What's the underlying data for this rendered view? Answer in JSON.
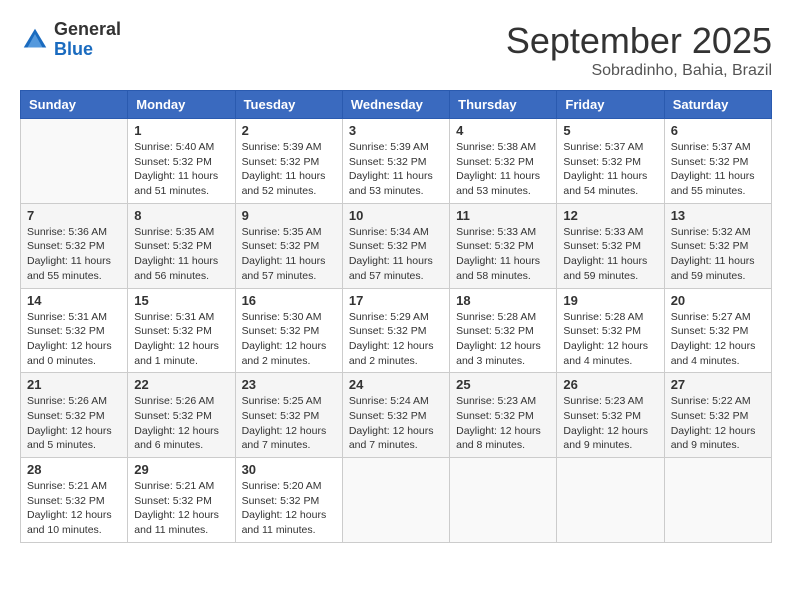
{
  "logo": {
    "general": "General",
    "blue": "Blue"
  },
  "header": {
    "month": "September 2025",
    "location": "Sobradinho, Bahia, Brazil"
  },
  "weekdays": [
    "Sunday",
    "Monday",
    "Tuesday",
    "Wednesday",
    "Thursday",
    "Friday",
    "Saturday"
  ],
  "weeks": [
    [
      {
        "day": "",
        "empty": true
      },
      {
        "day": "1",
        "sunrise": "5:40 AM",
        "sunset": "5:32 PM",
        "daylight": "11 hours and 51 minutes."
      },
      {
        "day": "2",
        "sunrise": "5:39 AM",
        "sunset": "5:32 PM",
        "daylight": "11 hours and 52 minutes."
      },
      {
        "day": "3",
        "sunrise": "5:39 AM",
        "sunset": "5:32 PM",
        "daylight": "11 hours and 53 minutes."
      },
      {
        "day": "4",
        "sunrise": "5:38 AM",
        "sunset": "5:32 PM",
        "daylight": "11 hours and 53 minutes."
      },
      {
        "day": "5",
        "sunrise": "5:37 AM",
        "sunset": "5:32 PM",
        "daylight": "11 hours and 54 minutes."
      },
      {
        "day": "6",
        "sunrise": "5:37 AM",
        "sunset": "5:32 PM",
        "daylight": "11 hours and 55 minutes."
      }
    ],
    [
      {
        "day": "7",
        "sunrise": "5:36 AM",
        "sunset": "5:32 PM",
        "daylight": "11 hours and 55 minutes."
      },
      {
        "day": "8",
        "sunrise": "5:35 AM",
        "sunset": "5:32 PM",
        "daylight": "11 hours and 56 minutes."
      },
      {
        "day": "9",
        "sunrise": "5:35 AM",
        "sunset": "5:32 PM",
        "daylight": "11 hours and 57 minutes."
      },
      {
        "day": "10",
        "sunrise": "5:34 AM",
        "sunset": "5:32 PM",
        "daylight": "11 hours and 57 minutes."
      },
      {
        "day": "11",
        "sunrise": "5:33 AM",
        "sunset": "5:32 PM",
        "daylight": "11 hours and 58 minutes."
      },
      {
        "day": "12",
        "sunrise": "5:33 AM",
        "sunset": "5:32 PM",
        "daylight": "11 hours and 59 minutes."
      },
      {
        "day": "13",
        "sunrise": "5:32 AM",
        "sunset": "5:32 PM",
        "daylight": "11 hours and 59 minutes."
      }
    ],
    [
      {
        "day": "14",
        "sunrise": "5:31 AM",
        "sunset": "5:32 PM",
        "daylight": "12 hours and 0 minutes."
      },
      {
        "day": "15",
        "sunrise": "5:31 AM",
        "sunset": "5:32 PM",
        "daylight": "12 hours and 1 minute."
      },
      {
        "day": "16",
        "sunrise": "5:30 AM",
        "sunset": "5:32 PM",
        "daylight": "12 hours and 2 minutes."
      },
      {
        "day": "17",
        "sunrise": "5:29 AM",
        "sunset": "5:32 PM",
        "daylight": "12 hours and 2 minutes."
      },
      {
        "day": "18",
        "sunrise": "5:28 AM",
        "sunset": "5:32 PM",
        "daylight": "12 hours and 3 minutes."
      },
      {
        "day": "19",
        "sunrise": "5:28 AM",
        "sunset": "5:32 PM",
        "daylight": "12 hours and 4 minutes."
      },
      {
        "day": "20",
        "sunrise": "5:27 AM",
        "sunset": "5:32 PM",
        "daylight": "12 hours and 4 minutes."
      }
    ],
    [
      {
        "day": "21",
        "sunrise": "5:26 AM",
        "sunset": "5:32 PM",
        "daylight": "12 hours and 5 minutes."
      },
      {
        "day": "22",
        "sunrise": "5:26 AM",
        "sunset": "5:32 PM",
        "daylight": "12 hours and 6 minutes."
      },
      {
        "day": "23",
        "sunrise": "5:25 AM",
        "sunset": "5:32 PM",
        "daylight": "12 hours and 7 minutes."
      },
      {
        "day": "24",
        "sunrise": "5:24 AM",
        "sunset": "5:32 PM",
        "daylight": "12 hours and 7 minutes."
      },
      {
        "day": "25",
        "sunrise": "5:23 AM",
        "sunset": "5:32 PM",
        "daylight": "12 hours and 8 minutes."
      },
      {
        "day": "26",
        "sunrise": "5:23 AM",
        "sunset": "5:32 PM",
        "daylight": "12 hours and 9 minutes."
      },
      {
        "day": "27",
        "sunrise": "5:22 AM",
        "sunset": "5:32 PM",
        "daylight": "12 hours and 9 minutes."
      }
    ],
    [
      {
        "day": "28",
        "sunrise": "5:21 AM",
        "sunset": "5:32 PM",
        "daylight": "12 hours and 10 minutes."
      },
      {
        "day": "29",
        "sunrise": "5:21 AM",
        "sunset": "5:32 PM",
        "daylight": "12 hours and 11 minutes."
      },
      {
        "day": "30",
        "sunrise": "5:20 AM",
        "sunset": "5:32 PM",
        "daylight": "12 hours and 11 minutes."
      },
      {
        "day": "",
        "empty": true
      },
      {
        "day": "",
        "empty": true
      },
      {
        "day": "",
        "empty": true
      },
      {
        "day": "",
        "empty": true
      }
    ]
  ],
  "labels": {
    "sunrise": "Sunrise:",
    "sunset": "Sunset:",
    "daylight": "Daylight:"
  }
}
